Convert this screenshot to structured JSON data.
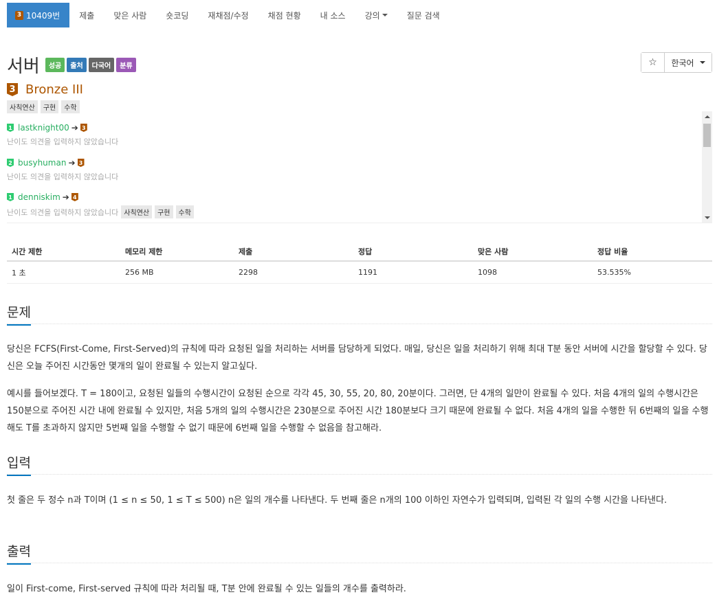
{
  "nav": {
    "problem_tier": "3",
    "problem_id": "10409번",
    "items": [
      "제출",
      "맞은 사람",
      "숏코딩",
      "재채점/수정",
      "채점 현황",
      "내 소스",
      "강의",
      "질문 검색"
    ]
  },
  "header": {
    "title": "서버",
    "labels": [
      "성공",
      "출처",
      "다국어",
      "분류"
    ],
    "star": "☆",
    "language": "한국어"
  },
  "tier": {
    "num": "3",
    "name": "Bronze III"
  },
  "tags": [
    "사칙연산",
    "구현",
    "수학"
  ],
  "opinions": [
    {
      "from": "1",
      "user": "lastknight00",
      "to": "3",
      "desc": "난이도 의견을 입력하지 않았습니다",
      "tags": []
    },
    {
      "from": "2",
      "user": "busyhuman",
      "to": "3",
      "desc": "난이도 의견을 입력하지 않았습니다",
      "tags": []
    },
    {
      "from": "1",
      "user": "denniskim",
      "to": "4",
      "desc": "난이도 의견을 입력하지 않았습니다",
      "tags": [
        "사칙연산",
        "구현",
        "수학"
      ]
    }
  ],
  "stats": {
    "headers": [
      "시간 제한",
      "메모리 제한",
      "제출",
      "정답",
      "맞은 사람",
      "정답 비율"
    ],
    "values": [
      "1 초",
      "256 MB",
      "2298",
      "1191",
      "1098",
      "53.535%"
    ]
  },
  "sections": {
    "problem_title": "문제",
    "problem_p1": "당신은 FCFS(First-Come, First-Served)의 규칙에 따라 요청된 일을 처리하는 서버를 담당하게 되었다. 매일, 당신은 일을 처리하기 위해 최대 T분 동안 서버에 시간을 할당할 수 있다. 당신은 오늘 주어진 시간동안 몇개의 일이 완료될 수 있는지 알고싶다.",
    "problem_p2": "예시를 들어보겠다. T = 180이고, 요청된 일들의 수행시간이 요청된 순으로 각각 45, 30, 55, 20, 80, 20분이다. 그러면, 단 4개의 일만이 완료될 수 있다. 처음 4개의 일의 수행시간은 150분으로 주어진 시간 내에 완료될 수 있지만, 처음 5개의 일의 수행시간은 230분으로 주어진 시간 180분보다 크기 때문에 완료될 수 없다. 처음 4개의 일을 수행한 뒤 6번째의 일을 수행해도 T를 초과하지 않지만 5번째 일을 수행할 수 없기 때문에 6번째 일을 수행할 수 없음을 참고해라.",
    "input_title": "입력",
    "input_p": "첫 줄은 두 정수 n과 T이며 (1 ≤ n ≤ 50, 1 ≤ T ≤ 500) n은 일의 개수를 나타낸다. 두 번째 줄은 n개의 100 이하인 자연수가 입력되며, 입력된 각 일의 수행 시간을 나타낸다.",
    "output_title": "출력",
    "output_p": "일이 First-come, First-served 규칙에 따라 처리될 때, T분 안에 완료될 수 있는 일들의 개수를 출력하라."
  }
}
